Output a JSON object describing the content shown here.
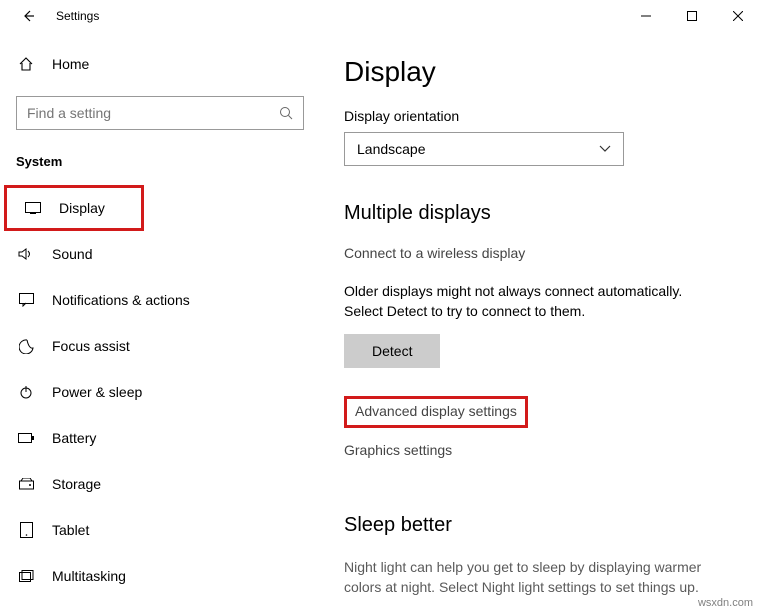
{
  "window": {
    "title": "Settings"
  },
  "sidebar": {
    "home": "Home",
    "search_placeholder": "Find a setting",
    "section": "System",
    "items": [
      {
        "label": "Display"
      },
      {
        "label": "Sound"
      },
      {
        "label": "Notifications & actions"
      },
      {
        "label": "Focus assist"
      },
      {
        "label": "Power & sleep"
      },
      {
        "label": "Battery"
      },
      {
        "label": "Storage"
      },
      {
        "label": "Tablet"
      },
      {
        "label": "Multitasking"
      }
    ]
  },
  "content": {
    "title": "Display",
    "orientation": {
      "label": "Display orientation",
      "value": "Landscape"
    },
    "multiple": {
      "heading": "Multiple displays",
      "wireless_link": "Connect to a wireless display",
      "older_text": "Older displays might not always connect automatically. Select Detect to try to connect to them.",
      "detect": "Detect",
      "advanced": "Advanced display settings",
      "graphics": "Graphics settings"
    },
    "sleep": {
      "heading": "Sleep better",
      "text": "Night light can help you get to sleep by displaying warmer colors at night. Select Night light settings to set things up."
    }
  },
  "watermark": "wsxdn.com"
}
